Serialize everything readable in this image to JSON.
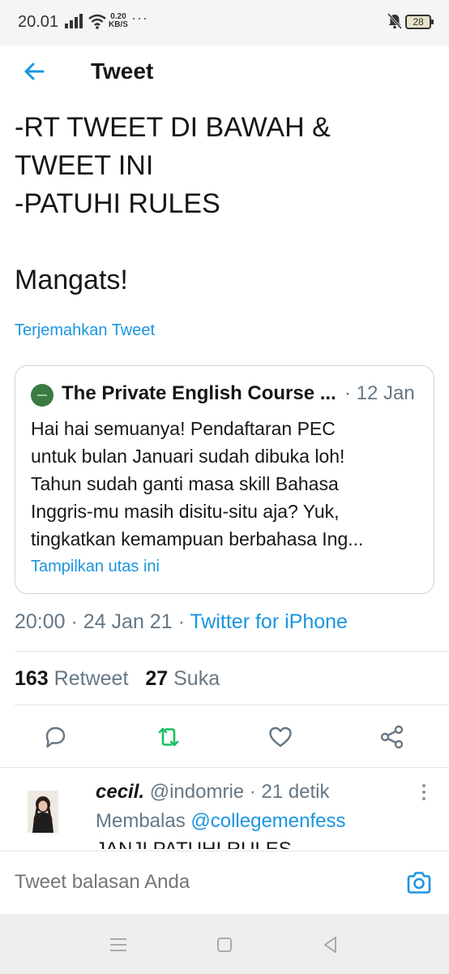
{
  "status_bar": {
    "time": "20.01",
    "net_speed_value": "0.20",
    "net_speed_unit": "KB/S",
    "more": "···",
    "battery": "28"
  },
  "header": {
    "title": "Tweet",
    "back_icon": "arrow-left-icon"
  },
  "tweet": {
    "text": "-RT TWEET DI BAWAH &\nTWEET INI\n-PATUHI RULES\n\nMangats!",
    "translate_label": "Terjemahkan Tweet",
    "time": "20:00",
    "date": "24 Jan 21",
    "separator": "·",
    "source": "Twitter for iPhone"
  },
  "quoted_tweet": {
    "name": "The Private English Course ...",
    "date": "· 12 Jan",
    "body_lines": [
      "Hai hai semuanya! Pendaftaran PEC",
      "untuk bulan Januari sudah dibuka loh!",
      "Tahun sudah ganti masa skill Bahasa",
      "Inggris-mu masih disitu-situ aja? Yuk,",
      "tingkatkan kemampuan berbahasa Ing..."
    ],
    "show_thread_label": "Tampilkan utas ini"
  },
  "stats": {
    "retweet_count": "163",
    "retweet_label": "Retweet",
    "like_count": "27",
    "like_label": "Suka"
  },
  "actions": {
    "reply_icon": "reply-icon",
    "retweet_icon": "retweet-icon",
    "retweet_color": "#17bf63",
    "like_icon": "heart-icon",
    "share_icon": "share-icon"
  },
  "reply": {
    "name": "cecil.",
    "handle": "@indomrie",
    "time": "· 21 detik",
    "replying_prefix": "Membalas",
    "replying_to": "@collegemenfess",
    "text_partial": "JANJI PATUHI RULES"
  },
  "composer": {
    "placeholder": "Tweet balasan Anda",
    "camera_icon": "camera-icon"
  },
  "colors": {
    "accent": "#1b95e0",
    "secondary_text": "#657786",
    "retweet_green": "#17bf63"
  }
}
